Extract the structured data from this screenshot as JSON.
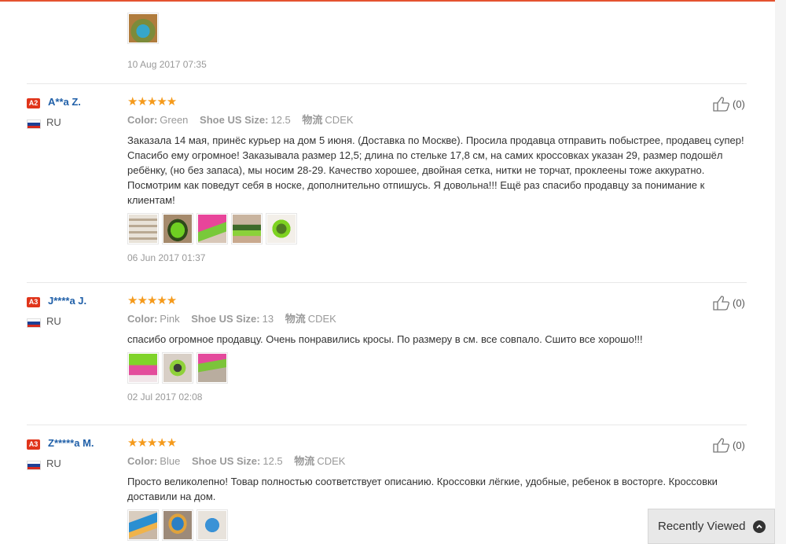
{
  "partial_review": {
    "date": "10 Aug 2017 07:35"
  },
  "reviews": [
    {
      "level": "A2",
      "user": "A**a Z.",
      "country": "RU",
      "stars": "★★★★★",
      "rating": 5,
      "color_label": "Color:",
      "color_value": "Green",
      "size_label": "Shoe US Size:",
      "size_value": "12.5",
      "shipping_label": "物流",
      "shipping_value": "CDEK",
      "text": "Заказала 14 мая, принёс курьер на дом 5 июня. (Доставка по Москве). Просила продавца отправить побыстрее, продавец супер! Спасибо ему огромное! Заказывала размер 12,5; длина по стельке 17,8 см, на самих кроссовках указан 29, размер подошёл ребёнку, (но без запаса), мы носим 28-29. Качество хорошее, двойная сетка, нитки не торчат, проклеены тоже аккуратно. Посмотрим как поведут себя в носке, дополнительно отпишусь. Я довольна!!! Ещё раз спасибо продавцу за понимание к клиентам!",
      "date": "06 Jun 2017 01:37",
      "helpful": "(0)"
    },
    {
      "level": "A3",
      "user": "J****a J.",
      "country": "RU",
      "stars": "★★★★★",
      "rating": 5,
      "color_label": "Color:",
      "color_value": "Pink",
      "size_label": "Shoe US Size:",
      "size_value": "13",
      "shipping_label": "物流",
      "shipping_value": "CDEK",
      "text": "спасибо огромное продавцу. Очень понравились кросы. По размеру в см. все совпало. Сшито все хорошо!!!",
      "date": "02 Jul 2017 02:08",
      "helpful": "(0)"
    },
    {
      "level": "A3",
      "user": "Z*****a M.",
      "country": "RU",
      "stars": "★★★★★",
      "rating": 5,
      "color_label": "Color:",
      "color_value": "Blue",
      "size_label": "Shoe US Size:",
      "size_value": "12.5",
      "shipping_label": "物流",
      "shipping_value": "CDEK",
      "text": "Просто великолепно! Товар полностью соответствует описанию. Кроссовки лёгкие, удобные, ребенок в восторге. Кроссовки доставили на дом.",
      "date": "",
      "helpful": "(0)"
    }
  ],
  "recently_viewed": {
    "label": "Recently Viewed",
    "icon": "chevron-up-circle-icon"
  },
  "colors": {
    "accent": "#e4522f",
    "username": "#1f5fa8",
    "stars": "#f59a1b",
    "badge": "#e0351b"
  }
}
